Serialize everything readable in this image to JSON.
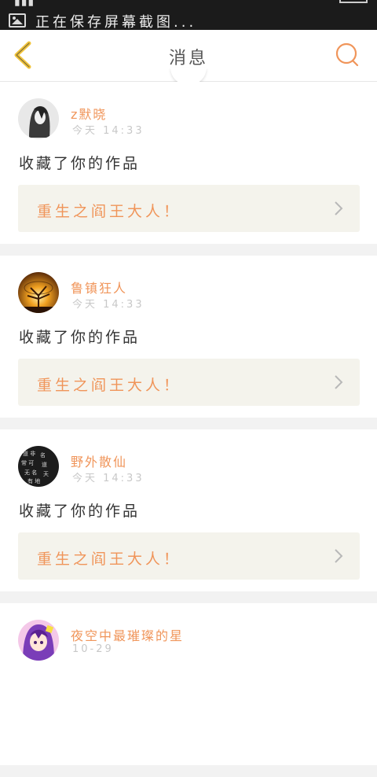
{
  "status_bar": {
    "notification_text": "正在保存屏幕截图...",
    "notification_icon": "image-icon"
  },
  "nav": {
    "title": "消息",
    "back_icon": "chevron-left-icon",
    "search_icon": "search-icon",
    "accent_color": "#f0955a",
    "back_color": "#f2c43a"
  },
  "messages": [
    {
      "username": "z默晓",
      "time": "今天 14:33",
      "action": "收藏了你的作品",
      "work_title": "重生之阎王大人！"
    },
    {
      "username": "鲁镇狂人",
      "time": "今天 14:33",
      "action": "收藏了你的作品",
      "work_title": "重生之阎王大人！"
    },
    {
      "username": "野外散仙",
      "time": "今天 14:33",
      "action": "收藏了你的作品",
      "work_title": "重生之阎王大人！"
    },
    {
      "username": "夜空中最璀璨的星",
      "time": "10-29",
      "action": "",
      "work_title": ""
    }
  ]
}
